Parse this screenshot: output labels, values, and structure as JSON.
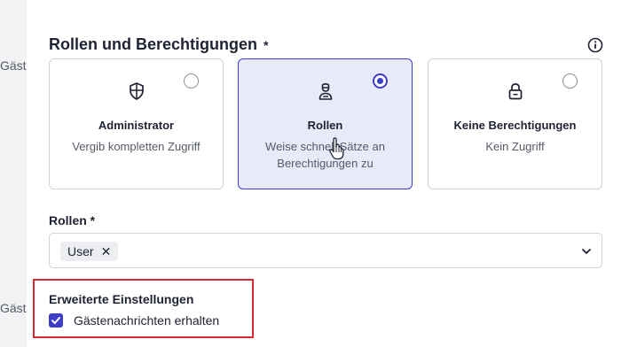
{
  "background": {
    "left_text_top": "Gäster",
    "left_text_bottom": "Gäste"
  },
  "section": {
    "title": "Rollen und Berechtigungen",
    "required_mark": "*",
    "info_icon": "info-icon"
  },
  "cards": [
    {
      "title": "Administrator",
      "desc": "Vergib kompletten Zugriff",
      "icon": "shield-icon",
      "selected": false
    },
    {
      "title": "Rollen",
      "desc": "Weise schnell Sätze an Berechtigungen zu",
      "icon": "person-icon",
      "selected": true
    },
    {
      "title": "Keine Berechtigungen",
      "desc": "Kein Zugriff",
      "icon": "lock-icon",
      "selected": false
    }
  ],
  "roles_field": {
    "label": "Rollen *",
    "chip": "User",
    "chip_remove": "✕",
    "dropdown_icon": "chevron-down-icon"
  },
  "advanced": {
    "title": "Erweiterte Einstellungen",
    "checkbox_label": "Gästenachrichten erhalten",
    "checked": true
  },
  "colors": {
    "accent": "#3d3dc8",
    "selected_bg": "#e8e9fb",
    "highlight_border": "#d9282f"
  }
}
